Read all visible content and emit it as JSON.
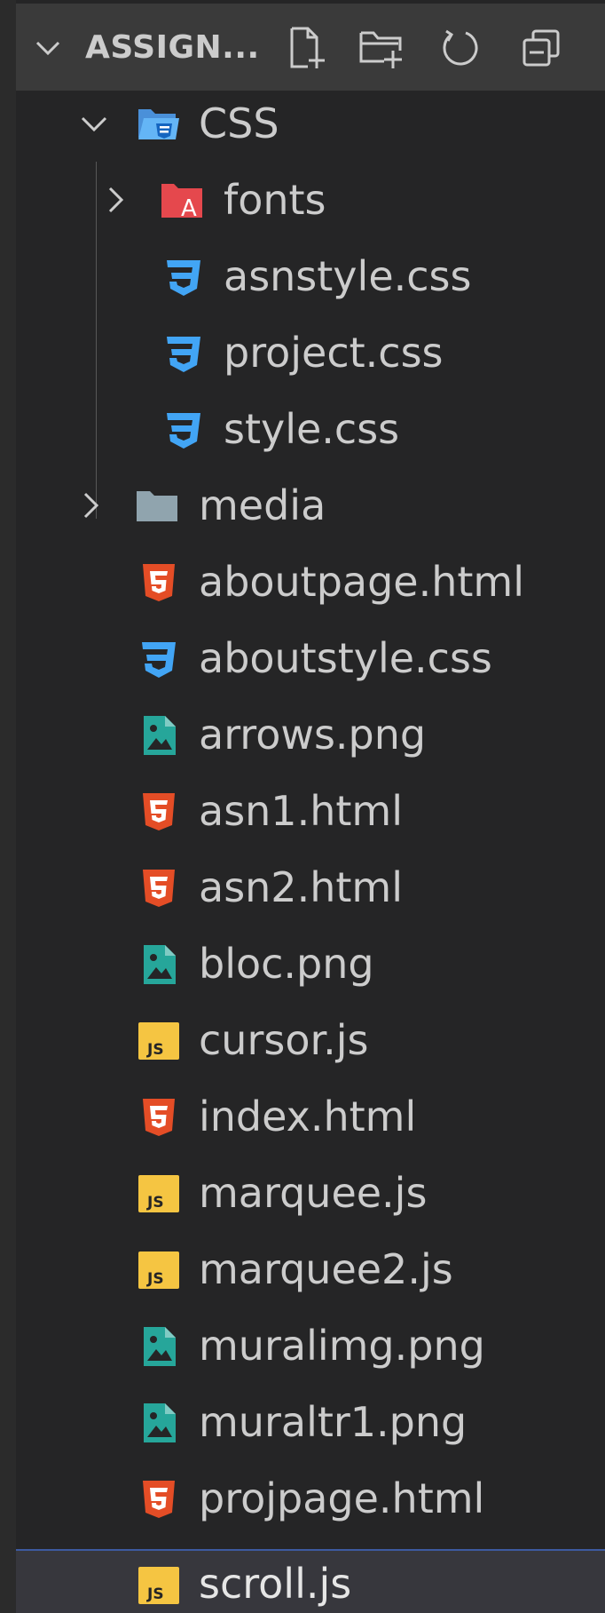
{
  "explorer": {
    "title": "ASSIGN..."
  },
  "tree": {
    "css_folder": "CSS",
    "fonts_folder": "fonts",
    "asnstyle": "asnstyle.css",
    "project": "project.css",
    "style": "style.css",
    "media_folder": "media",
    "aboutpage": "aboutpage.html",
    "aboutstyle": "aboutstyle.css",
    "arrows": "arrows.png",
    "asn1": "asn1.html",
    "asn2": "asn2.html",
    "bloc": "bloc.png",
    "cursor": "cursor.js",
    "index": "index.html",
    "marquee": "marquee.js",
    "marquee2": "marquee2.js",
    "muralimg": "muralimg.png",
    "muraltr1": "muraltr1.png",
    "projpage": "projpage.html",
    "scroll": "scroll.js"
  },
  "colors": {
    "background": "#252526",
    "header": "#3a3a3a",
    "text": "#cccccc",
    "selected_row": "#37373d",
    "css_icon": "#42a5f5",
    "html_icon": "#e44d26",
    "js_icon": "#f5c542",
    "image_icon": "#26a69a",
    "fonts_folder": "#e5484d",
    "media_folder": "#90a4ae"
  }
}
